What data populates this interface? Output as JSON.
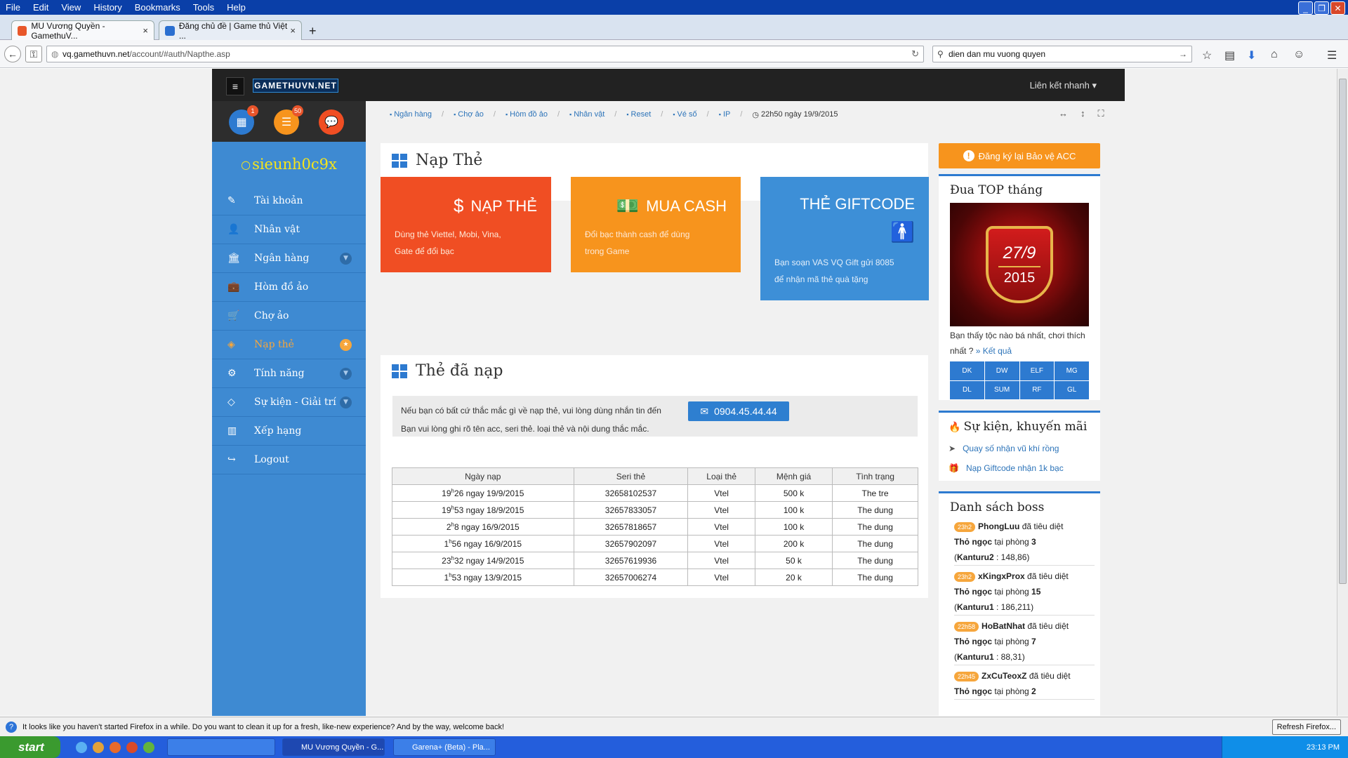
{
  "menu": [
    "File",
    "Edit",
    "View",
    "History",
    "Bookmarks",
    "Tools",
    "Help"
  ],
  "window_controls": [
    "_",
    "❐",
    "✕"
  ],
  "tabs": [
    {
      "title": "MU Vương Quyền - GamethuV...",
      "close": "×"
    },
    {
      "title": "Đăng chủ đề | Game thủ Việt ...",
      "close": "×"
    }
  ],
  "newtab": "+",
  "url": {
    "host": "vq.gamethuvn.net",
    "path": "/account/#auth/Napthe.asp"
  },
  "search": {
    "value": "dien dan mu vuong quyen"
  },
  "site": {
    "logo": "GAMETHUVN.NET",
    "quick_links": "Liên kết nhanh ▾",
    "badges": {
      "calendar": "1",
      "list": "50"
    },
    "username": "sieunh0c9x"
  },
  "sidebar": [
    {
      "label": "Tài khoản",
      "icon": "✎",
      "chev": ""
    },
    {
      "label": "Nhân vật",
      "icon": "👤",
      "chev": ""
    },
    {
      "label": "Ngân hàng",
      "icon": "🏛",
      "chev": "▼"
    },
    {
      "label": "Hòm đồ ảo",
      "icon": "💼",
      "chev": ""
    },
    {
      "label": "Chợ ảo",
      "icon": "🛒",
      "chev": ""
    },
    {
      "label": "Nạp thẻ",
      "icon": "◈",
      "chev": "★"
    },
    {
      "label": "Tính năng",
      "icon": "⚙",
      "chev": "▼"
    },
    {
      "label": "Sự kiện - Giải trí",
      "icon": "◇",
      "chev": "▼"
    },
    {
      "label": "Xếp hạng",
      "icon": "▥",
      "chev": ""
    },
    {
      "label": "Logout",
      "icon": "↪",
      "chev": ""
    }
  ],
  "breadcrumbs": [
    "Ngân hàng",
    "Chợ ảo",
    "Hòm đồ ảo",
    "Nhân vật",
    "Reset",
    "Vé số",
    "IP"
  ],
  "datetime": "22h50 ngày 19/9/2015",
  "page_title": "Nạp Thẻ",
  "cards": [
    {
      "title": "NẠP THẺ",
      "icon": "$",
      "desc1": "Dùng thẻ Viettel, Mobi, Vina,",
      "desc2": "Gate để đổi bạc",
      "color": "#f04e23"
    },
    {
      "title": "MUA CASH",
      "icon": "💵",
      "desc1": "Đổi bạc thành cash để dùng",
      "desc2": "trong Game",
      "color": "#f7941d"
    },
    {
      "title": "THẺ GIFTCODE",
      "icon": "🚹",
      "desc1": "Bạn soạn VAS VQ Gift gửi 8085",
      "desc2": "để nhận mã thẻ quà tặng",
      "color": "#3d8fd7"
    }
  ],
  "history": {
    "title": "Thẻ đã nạp",
    "notice1": "Nếu bạn có bất cứ thắc mắc gì về nạp thẻ, vui lòng dùng nhắn tin đến",
    "phone": "0904.45.44.44",
    "notice2": "Bạn vui lòng ghi rõ tên acc, seri thẻ. loại thẻ và nội dung thắc mắc.",
    "columns": [
      "Ngày nạp",
      "Seri thẻ",
      "Loại thẻ",
      "Mệnh giá",
      "Tình trạng"
    ],
    "rows": [
      [
        "19h26 ngay 19/9/2015",
        "32658102537",
        "Vtel",
        "500 k",
        "The tre"
      ],
      [
        "19h53 ngay 18/9/2015",
        "32657833057",
        "Vtel",
        "100 k",
        "The dung"
      ],
      [
        "2h8 ngay 16/9/2015",
        "32657818657",
        "Vtel",
        "100 k",
        "The dung"
      ],
      [
        "1h56 ngay 16/9/2015",
        "32657902097",
        "Vtel",
        "200 k",
        "The dung"
      ],
      [
        "23h32 ngay 14/9/2015",
        "32657619936",
        "Vtel",
        "50 k",
        "The dung"
      ],
      [
        "1h53 ngay 13/9/2015",
        "32657006274",
        "Vtel",
        "20 k",
        "The dung"
      ]
    ]
  },
  "right": {
    "register_btn": "Đăng ký lại Bảo vệ ACC",
    "top_title": "Đua TOP tháng",
    "top_badge_top": "27/9",
    "top_badge_bottom": "2015",
    "top_text": "Bạn thấy tộc nào bá nhất, chơi thích nhất ?",
    "top_link": "» Kết quả",
    "classes": [
      "DK",
      "DW",
      "ELF",
      "MG",
      "DL",
      "SUM",
      "RF",
      "GL"
    ],
    "events_title": "Sự kiện, khuyến mãi",
    "events": [
      "Quay số nhận vũ khí rồng",
      "Nạp Giftcode nhận 1k bạc"
    ],
    "boss_title": "Danh sách boss",
    "boss": [
      {
        "time": "23h2",
        "player": "PhongLuu",
        "mid": " đã tiêu diệt",
        "boss": "Thỏ ngọc",
        "room": " tại phòng ",
        "roomno": "3",
        "map": "Kanturu2",
        "coord": " : 148,86)"
      },
      {
        "time": "23h2",
        "player": "xKingxProx",
        "mid": " đã tiêu diệt",
        "boss": "Thỏ ngọc",
        "room": " tại phòng ",
        "roomno": "15",
        "map": "Kanturu1",
        "coord": " : 186,211)"
      },
      {
        "time": "22h58",
        "player": "HoBatNhat",
        "mid": " đã tiêu diệt",
        "boss": "Thỏ ngọc",
        "room": " tại phòng ",
        "roomno": "7",
        "map": "Kanturu1",
        "coord": " : 88,31)"
      },
      {
        "time": "22h45",
        "player": "ZxCuTeoxZ",
        "mid": " đã tiêu diệt",
        "boss": "Thỏ ngọc",
        "room": " tại phòng ",
        "roomno": "2",
        "map": "",
        "coord": ""
      }
    ]
  },
  "notification": {
    "text": "It looks like you haven't started Firefox in a while. Do you want to clean it up for a fresh, like-new experience? And by the way, welcome back!",
    "button": "Refresh Firefox..."
  },
  "taskbar": {
    "start": "start",
    "items": [
      "MU Vương Quyền - G...",
      "Garena+ (Beta) - Pla..."
    ],
    "clock": "23:13 PM"
  }
}
